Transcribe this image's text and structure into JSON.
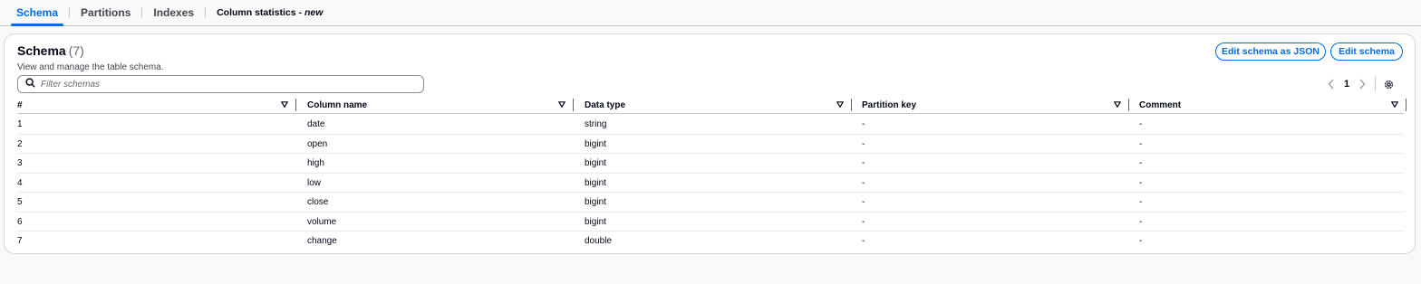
{
  "tabs": [
    {
      "label": "Schema"
    },
    {
      "label": "Partitions"
    },
    {
      "label": "Indexes"
    },
    {
      "label": "Column statistics -",
      "badge": "new"
    }
  ],
  "schema": {
    "title": "Schema",
    "count": "(7)",
    "description": "View and manage the table schema.",
    "edit_json_label": "Edit schema as JSON",
    "edit_label": "Edit schema",
    "filter_placeholder": "Filter schemas",
    "page": "1"
  },
  "columns": [
    "#",
    "Column name",
    "Data type",
    "Partition key",
    "Comment"
  ],
  "rows": [
    [
      "1",
      "date",
      "string",
      "-",
      "-"
    ],
    [
      "2",
      "open",
      "bigint",
      "-",
      "-"
    ],
    [
      "3",
      "high",
      "bigint",
      "-",
      "-"
    ],
    [
      "4",
      "low",
      "bigint",
      "-",
      "-"
    ],
    [
      "5",
      "close",
      "bigint",
      "-",
      "-"
    ],
    [
      "6",
      "volume",
      "bigint",
      "-",
      "-"
    ],
    [
      "7",
      "change",
      "double",
      "-",
      "-"
    ]
  ],
  "colors": {
    "accent": "#006ce0",
    "text": "#000716"
  }
}
